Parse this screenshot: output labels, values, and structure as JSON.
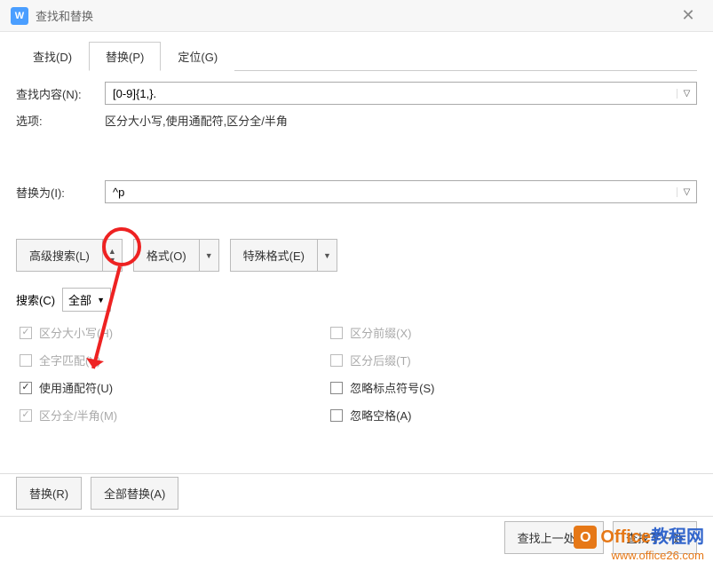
{
  "title": "查找和替换",
  "tabs": {
    "find": "查找(D)",
    "replace": "替换(P)",
    "goto": "定位(G)"
  },
  "find_label": "查找内容(N):",
  "find_value": "[0-9]{1,}.",
  "options_label": "选项:",
  "options_value": "区分大小写,使用通配符,区分全/半角",
  "replace_label": "替换为(I):",
  "replace_value": "^p",
  "advanced_btn": "高级搜索(L)",
  "format_btn": "格式(O)",
  "special_btn": "特殊格式(E)",
  "search_label": "搜索(C)",
  "search_scope": "全部",
  "checks_left": [
    {
      "label": "区分大小写(H)",
      "checked": true,
      "disabled": true
    },
    {
      "label": "全字匹配(Y)",
      "checked": false,
      "disabled": true
    },
    {
      "label": "使用通配符(U)",
      "checked": true,
      "disabled": false
    },
    {
      "label": "区分全/半角(M)",
      "checked": true,
      "disabled": true
    }
  ],
  "checks_right": [
    {
      "label": "区分前缀(X)",
      "checked": false,
      "disabled": true
    },
    {
      "label": "区分后缀(T)",
      "checked": false,
      "disabled": true
    },
    {
      "label": "忽略标点符号(S)",
      "checked": false,
      "disabled": false
    },
    {
      "label": "忽略空格(A)",
      "checked": false,
      "disabled": false
    }
  ],
  "replace_btn": "替换(R)",
  "replace_all_btn": "全部替换(A)",
  "find_prev_btn": "查找上一处(B)",
  "find_next_btn": "查找下一处",
  "watermark": {
    "brand1": "Office",
    "brand2": "教程网",
    "url": "www.office26.com"
  }
}
